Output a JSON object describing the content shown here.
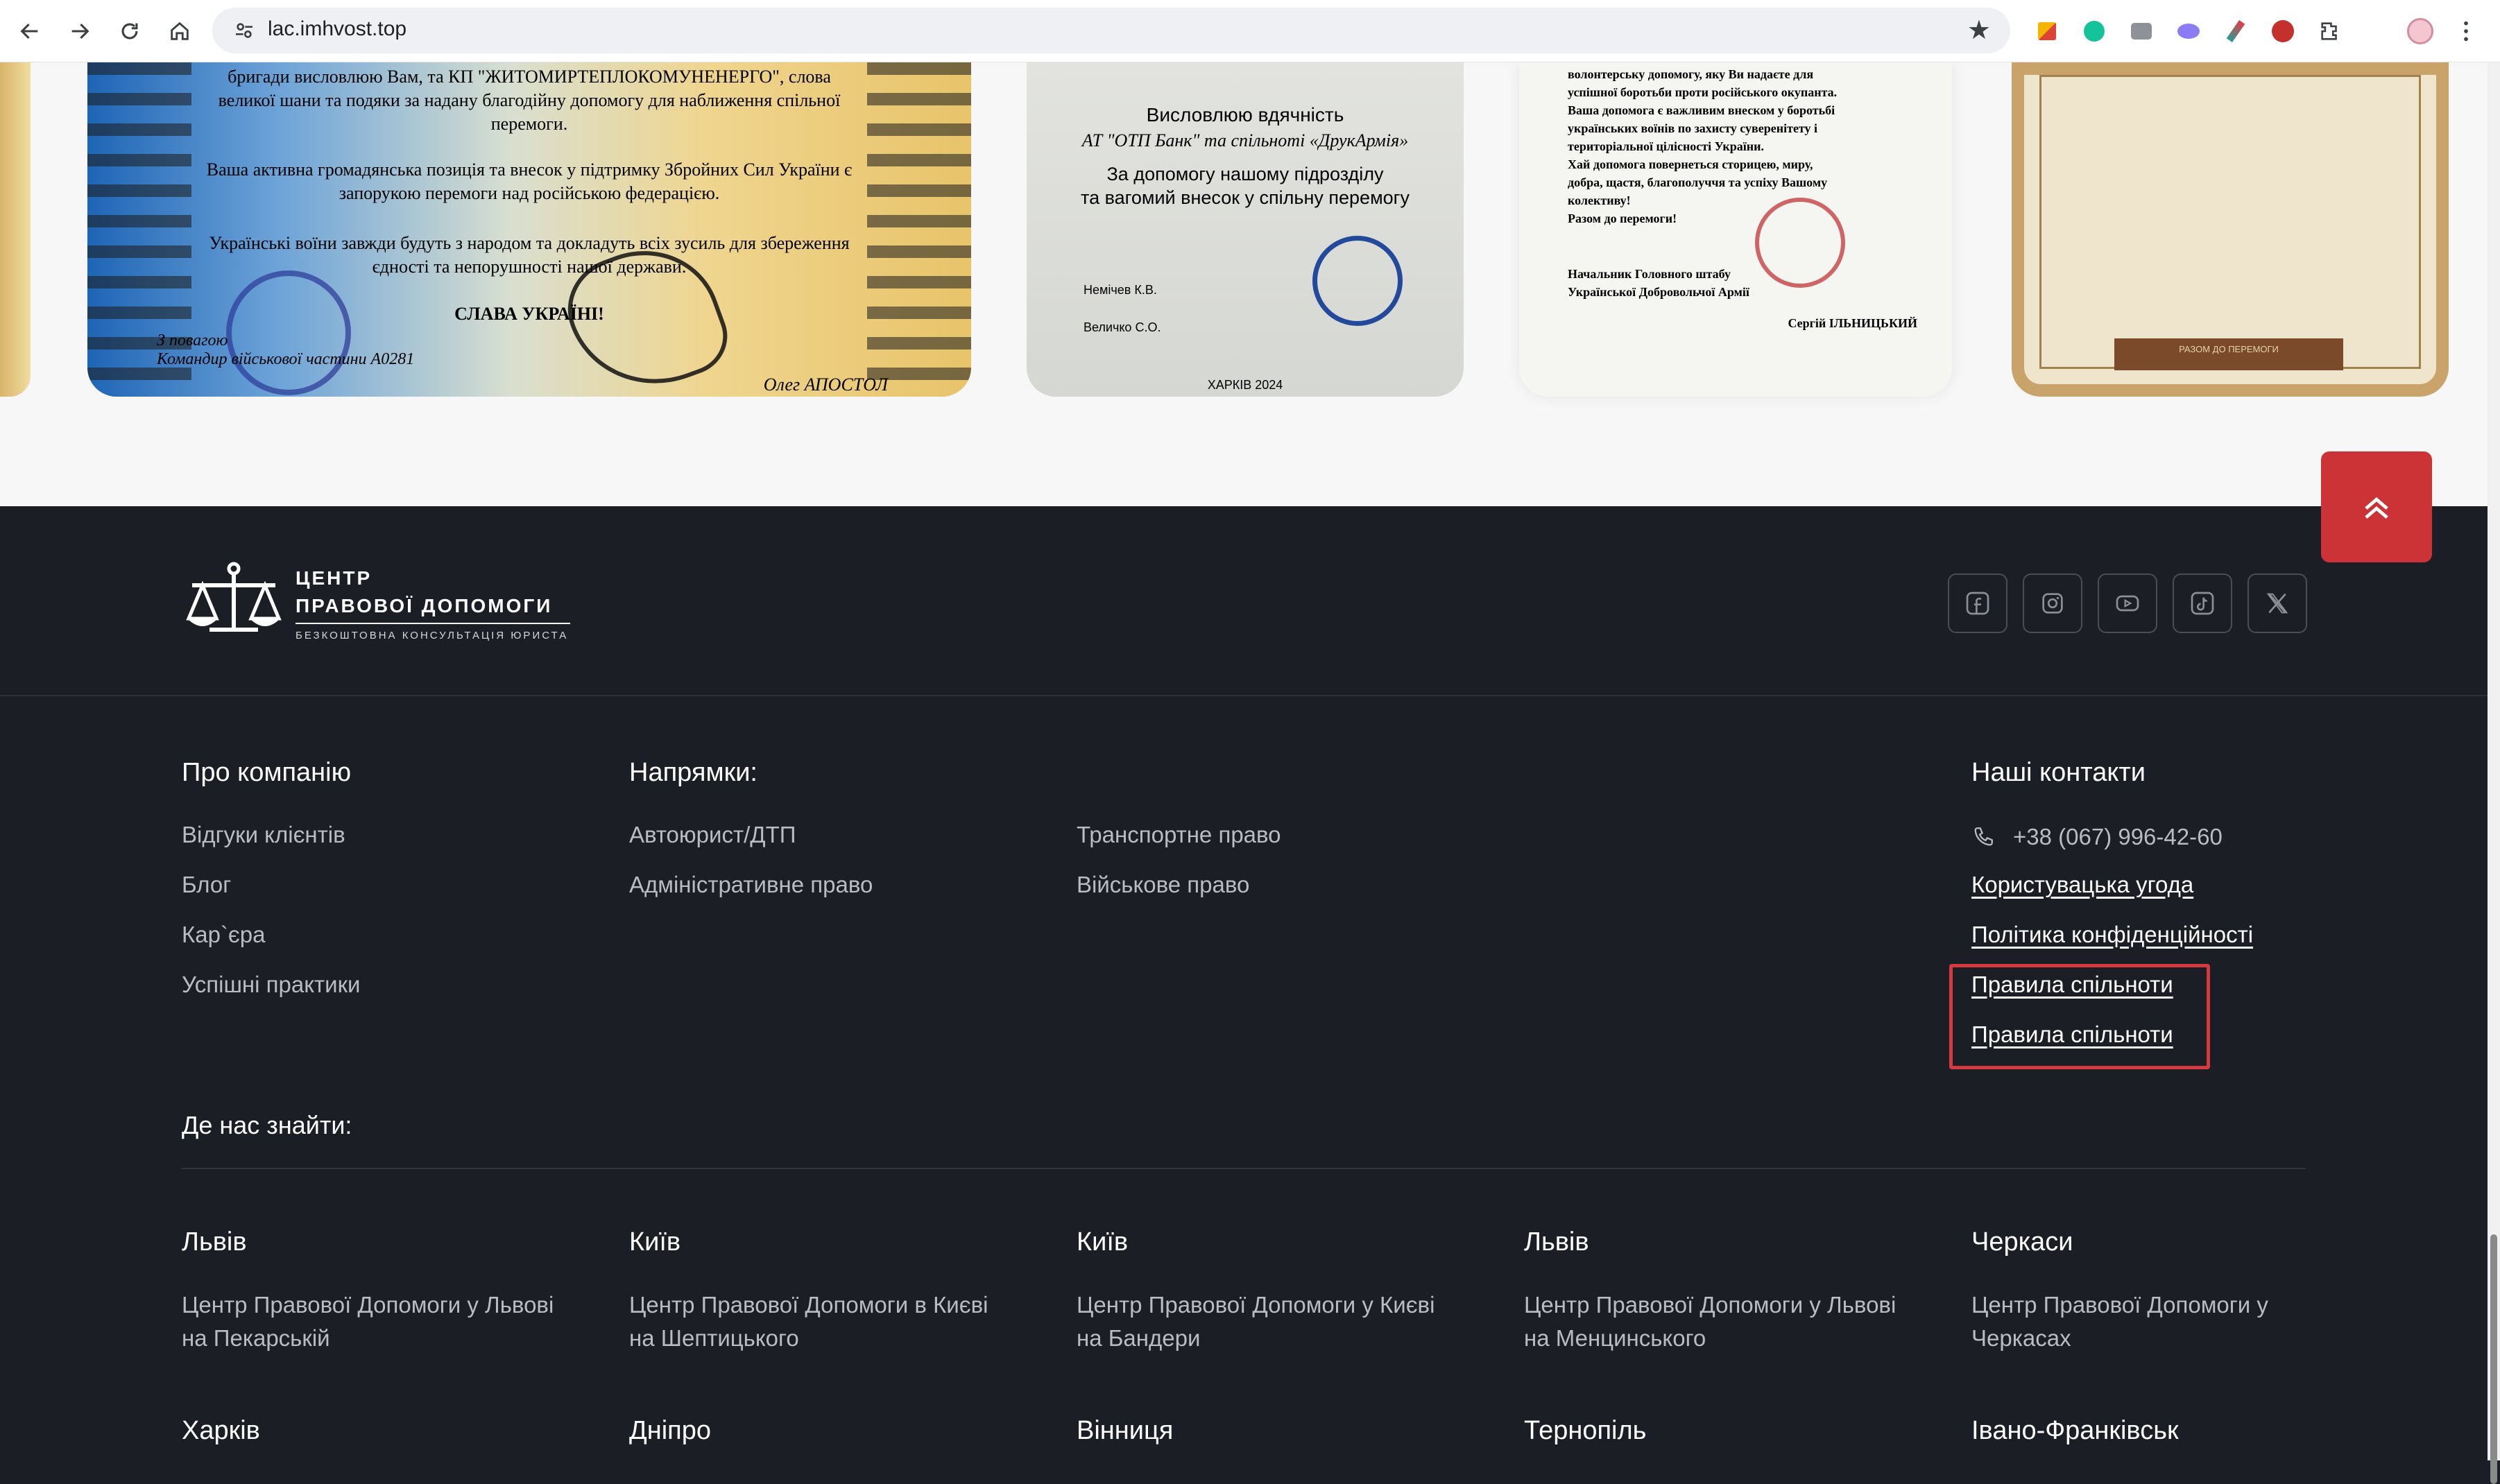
{
  "browser": {
    "url": "lac.imhvost.top"
  },
  "certificates": {
    "cert1_lines": [
      "бригади висловлюю Вам, та КП \"ЖИТОМИРТЕПЛОКОМУНЕНЕРГО\", слова",
      "великої шани та подяки за надану благодійну допомогу для наближення спільної",
      "перемоги.",
      "Ваша активна громадянська позиція та внесок у підтримку Збройних Сил України є",
      "запорукою перемоги над російською федерацією.",
      "Українські воїни завжди будуть з народом та докладуть всіх зусиль для збереження",
      "єдності та непорушності нашої держави.",
      "СЛАВА УКРАЇНІ!"
    ],
    "cert1_sign_left": "З повагою\nКомандир військової частини А0281",
    "cert1_sign_right": "Олег АПОСТОЛ",
    "cert2_title": "Висловлюю вдячність",
    "cert2_subtitle": "АТ \"ОТП Банк\" та спільноті «ДрукАрмія»",
    "cert2_body": "За допомогу нашому підрозділу\nта вагомий внесок у спільну перемогу",
    "cert2_name1": "Немічев К.В.",
    "cert2_name2": "Величко С.О.",
    "cert2_city": "ХАРКІВ 2024",
    "cert3_body": "волонтерську допомогу, яку Ви надаєте для\nуспішної боротьби проти російського окупанта.\nВаша допомога є важливим внеском у боротьбі\nукраїнських воїнів по захисту суверенітету і\nтериторіальної цілісності України.\nХай допомога повернеться сторицею, миру,\nдобра, щастя, благополуччя та успіху Вашому\nколективу!\nРазом до перемоги!",
    "cert3_sign": "Начальник Головного штабу\nУкраїнської Добровольчої Армії",
    "cert3_name": "Сергій ІЛЬНИЦЬКИЙ",
    "cert4_ribbon": "РАЗОМ ДО ПЕРЕМОГИ"
  },
  "footer": {
    "logo": {
      "line1": "ЦЕНТР",
      "line2": "ПРАВОВОЇ ДОПОМОГИ",
      "line3": "БЕЗКОШТОВНА КОНСУЛЬТАЦІЯ ЮРИСТА"
    },
    "socials": [
      "facebook-icon",
      "instagram-icon",
      "youtube-icon",
      "tiktok-icon",
      "x-icon"
    ],
    "about": {
      "title": "Про компанію",
      "links": [
        "Відгуки клієнтів",
        "Блог",
        "Кар`єра",
        "Успішні практики"
      ]
    },
    "directions": {
      "title": "Напрямки:",
      "col1": [
        "Автоюрист/ДТП",
        "Адміністративне право"
      ],
      "col2": [
        "Транспортне право",
        "Військове право"
      ]
    },
    "contacts": {
      "title": "Наші контакти",
      "phone": "+38 (067) 996-42-60",
      "links": [
        "Користувацька угода",
        "Політика конфіденційності",
        "Правила спільноти",
        "Правила спільноти"
      ]
    },
    "locations": {
      "title": "Де нас знайти:",
      "row1": [
        {
          "city": "Львів",
          "office": "Центр Правової Допомоги у Львові на Пекарській"
        },
        {
          "city": "Київ",
          "office": "Центр Правової Допомоги в Києві на Шептицького"
        },
        {
          "city": "Київ",
          "office": "Центр Правової Допомоги у Києві на Бандери"
        },
        {
          "city": "Львів",
          "office": "Центр Правової Допомоги у Львові на Менцинського"
        },
        {
          "city": "Черкаси",
          "office": "Центр Правової Допомоги у Черкасах"
        }
      ],
      "row2": [
        {
          "city": "Харків"
        },
        {
          "city": "Дніпро"
        },
        {
          "city": "Вінниця"
        },
        {
          "city": "Тернопіль"
        },
        {
          "city": "Івано-Франківськ"
        }
      ]
    }
  },
  "colors": {
    "footer_bg": "#1b1e25",
    "accent_red": "#cc3337",
    "muted_text": "#b9bcc4"
  }
}
